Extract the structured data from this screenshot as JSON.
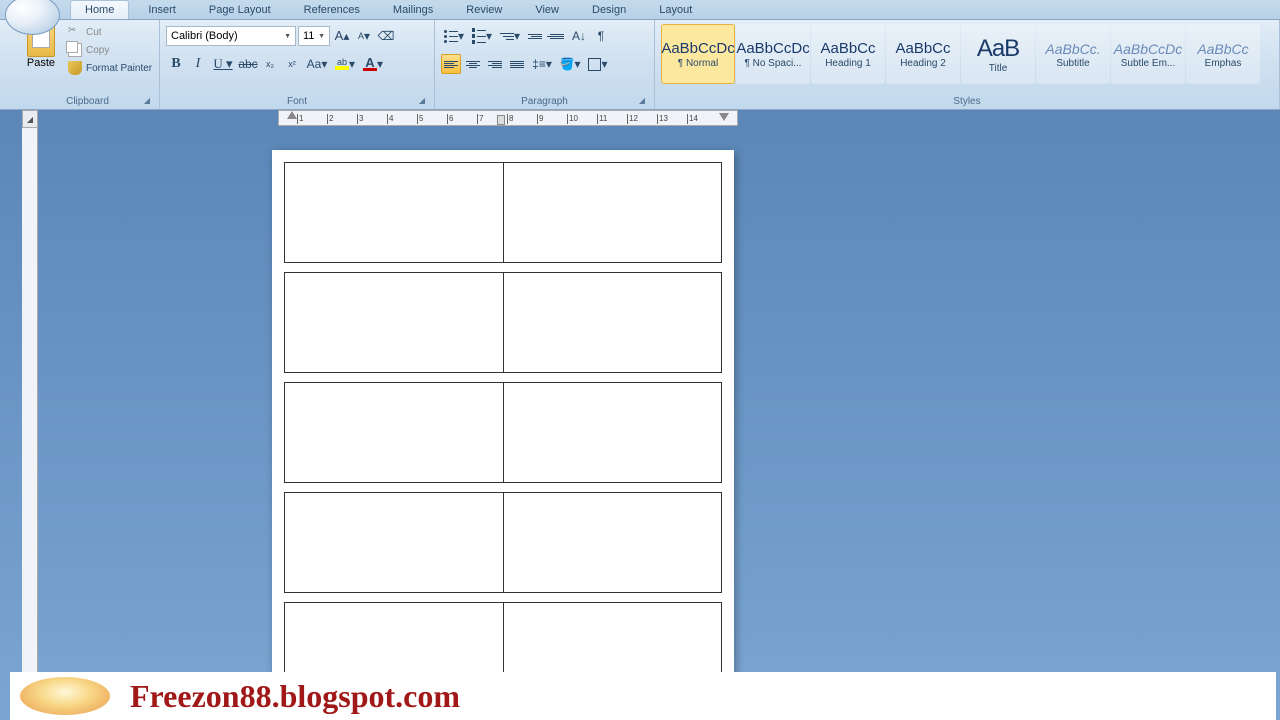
{
  "tabs": {
    "home": "Home",
    "insert": "Insert",
    "pagelayout": "Page Layout",
    "references": "References",
    "mailings": "Mailings",
    "review": "Review",
    "view": "View",
    "design": "Design",
    "layout": "Layout"
  },
  "clipboard": {
    "paste": "Paste",
    "cut": "Cut",
    "copy": "Copy",
    "format_painter": "Format Painter",
    "label": "Clipboard"
  },
  "font": {
    "name": "Calibri (Body)",
    "size": "11",
    "label": "Font"
  },
  "paragraph": {
    "label": "Paragraph"
  },
  "styles": {
    "label": "Styles",
    "items": [
      {
        "preview": "AaBbCcDc",
        "label": "¶ Normal",
        "cls": ""
      },
      {
        "preview": "AaBbCcDc",
        "label": "¶ No Spaci...",
        "cls": ""
      },
      {
        "preview": "AaBbCc",
        "label": "Heading 1",
        "cls": ""
      },
      {
        "preview": "AaBbCc",
        "label": "Heading 2",
        "cls": ""
      },
      {
        "preview": "AaB",
        "label": "Title",
        "cls": "title"
      },
      {
        "preview": "AaBbCc.",
        "label": "Subtitle",
        "cls": "sub"
      },
      {
        "preview": "AaBbCcDc",
        "label": "Subtle Em...",
        "cls": "sub"
      },
      {
        "preview": "AaBbCc",
        "label": "Emphas",
        "cls": "sub"
      }
    ]
  },
  "ruler": {
    "marks": [
      "1",
      "2",
      "3",
      "4",
      "5",
      "6",
      "7",
      "8",
      "9",
      "10",
      "11",
      "12",
      "13",
      "14"
    ]
  },
  "watermark": "Freezon88.blogspot.com"
}
